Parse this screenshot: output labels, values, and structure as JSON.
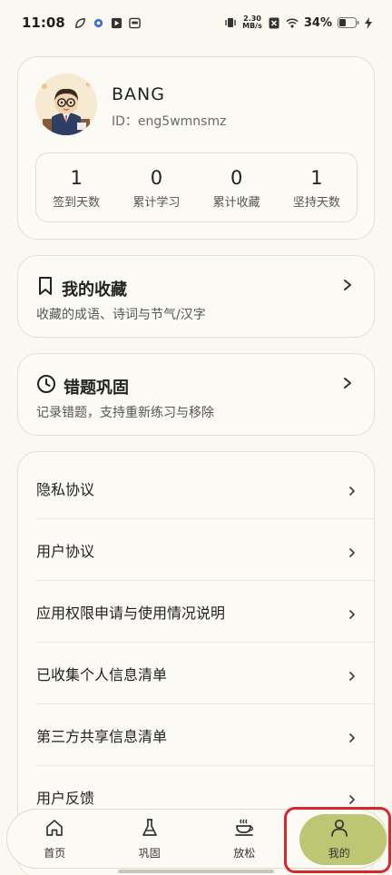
{
  "status_bar": {
    "time": "11:08",
    "net_speed_value": "2.30",
    "net_speed_unit": "MB/s",
    "battery": "34%"
  },
  "profile": {
    "name": "BANG",
    "id": "ID：eng5wmnsmz",
    "stats": [
      {
        "value": "1",
        "label": "签到天数"
      },
      {
        "value": "0",
        "label": "累计学习"
      },
      {
        "value": "0",
        "label": "累计收藏"
      },
      {
        "value": "1",
        "label": "坚持天数"
      }
    ]
  },
  "favorites": {
    "title": "我的收藏",
    "desc": "收藏的成语、诗词与节气/汉字",
    "icon": "bookmark-icon"
  },
  "mistakes": {
    "title": "错题巩固",
    "desc": "记录错题，支持重新练习与移除",
    "icon": "clock-icon"
  },
  "menu_list": [
    {
      "label": "隐私协议"
    },
    {
      "label": "用户协议"
    },
    {
      "label": "应用权限申请与使用情况说明"
    },
    {
      "label": "已收集个人信息清单"
    },
    {
      "label": "第三方共享信息清单"
    },
    {
      "label": "用户反馈"
    }
  ],
  "bottom_nav": [
    {
      "label": "首页",
      "icon": "home-icon"
    },
    {
      "label": "巩固",
      "icon": "flask-icon"
    },
    {
      "label": "放松",
      "icon": "coffee-cup-icon"
    },
    {
      "label": "我的",
      "icon": "user-icon",
      "active": true
    }
  ],
  "colors": {
    "background": "#FBF8F1",
    "card_border": "#E7DFCF",
    "active_tab": "#BCC673",
    "highlight": "#D8262B"
  }
}
